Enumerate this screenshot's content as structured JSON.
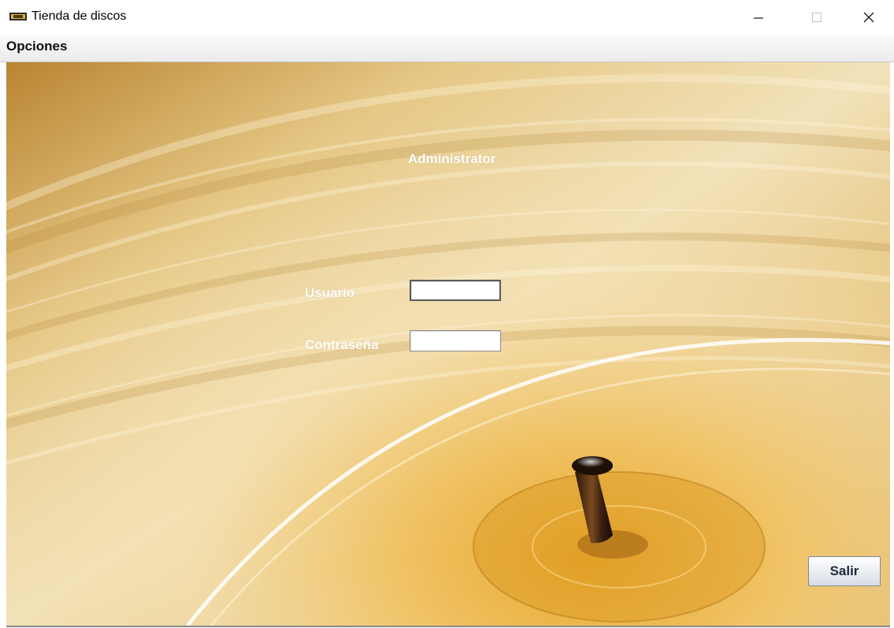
{
  "window": {
    "title": "Tienda de discos",
    "controls": [
      "minimize-icon",
      "maximize-icon",
      "close-icon"
    ]
  },
  "menubar": {
    "items": [
      {
        "label": "Opciones"
      }
    ]
  },
  "panel": {
    "heading": "Administrator",
    "usuario_label": "Usuario",
    "usuario_value": "",
    "contrasena_label": "Contraseña",
    "contrasena_value": "",
    "exit_button": "Salir"
  },
  "colors": {
    "gold_light": "#f3e2b4",
    "gold_mid": "#d9ab52",
    "gold_dark": "#a46d1e",
    "label_text": "#ffffff"
  }
}
